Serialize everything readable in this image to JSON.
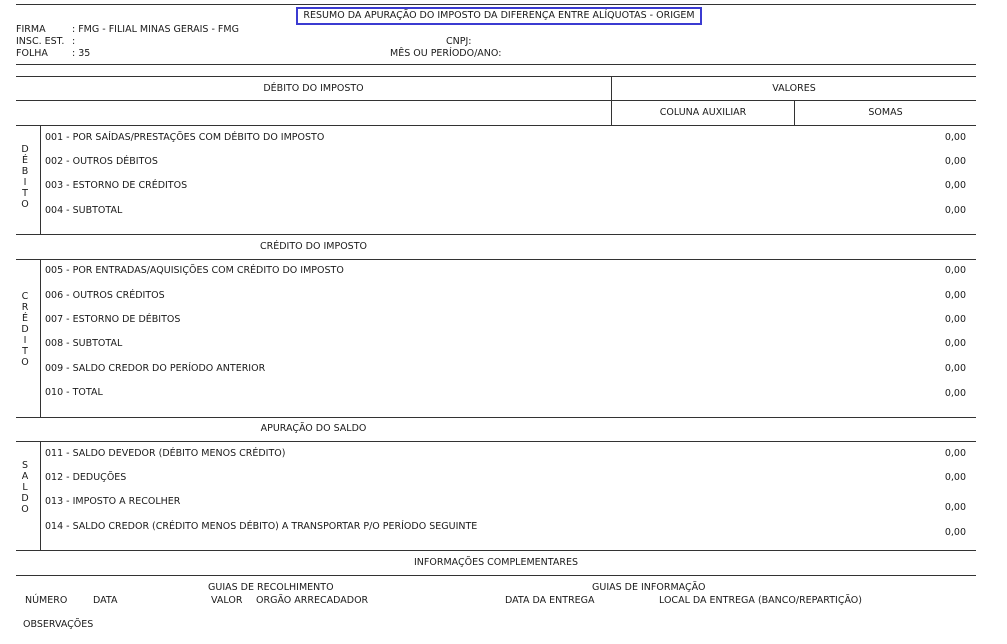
{
  "title": "RESUMO DA APURAÇÃO DO IMPOSTO DA DIFERENÇA ENTRE ALÍQUOTAS - ORIGEM",
  "header": {
    "firma_label": "FIRMA",
    "firma_value": ": FMG - FILIAL MINAS GERAIS - FMG",
    "insc_label": "INSC. EST.",
    "insc_value": ":",
    "folha_label": "FOLHA",
    "folha_value": ": 35",
    "cnpj_label": "CNPJ:",
    "periodo_label": "MÊS OU PERÍODO/ANO:"
  },
  "table_head": {
    "debito_imposto": "DÉBITO DO IMPOSTO",
    "valores": "VALORES",
    "coluna_auxiliar": "COLUNA AUXILIAR",
    "somas": "SOMAS"
  },
  "debito": {
    "side": "DÉBITO",
    "rows": [
      {
        "label": "001 - POR SAÍDAS/PRESTAÇÕES COM DÉBITO DO IMPOSTO",
        "value": "0,00"
      },
      {
        "label": "002 - OUTROS DÉBITOS",
        "value": "0,00"
      },
      {
        "label": "003 - ESTORNO DE CRÉDITOS",
        "value": "0,00"
      },
      {
        "label": "004 - SUBTOTAL",
        "value": "0,00"
      }
    ]
  },
  "credito": {
    "heading": "CRÉDITO DO IMPOSTO",
    "side": "CRÉDITO",
    "rows": [
      {
        "label": "005 - POR ENTRADAS/AQUISIÇÕES COM CRÉDITO DO IMPOSTO",
        "value": "0,00"
      },
      {
        "label": "006 - OUTROS CRÉDITOS",
        "value": "0,00"
      },
      {
        "label": "007 - ESTORNO DE DÉBITOS",
        "value": "0,00"
      },
      {
        "label": "008 - SUBTOTAL",
        "value": "0,00"
      },
      {
        "label": "009 - SALDO CREDOR DO PERÍODO ANTERIOR",
        "value": "0,00"
      },
      {
        "label": "010 - TOTAL",
        "value": "0,00"
      }
    ]
  },
  "saldo": {
    "heading": "APURAÇÃO DO SALDO",
    "side": "SALDO",
    "rows": [
      {
        "label": "011 - SALDO DEVEDOR (DÉBITO MENOS CRÉDITO)",
        "value": "0,00"
      },
      {
        "label": "012 - DEDUÇÕES",
        "value": "0,00"
      },
      {
        "label": "013 - IMPOSTO A RECOLHER",
        "value": "0,00"
      },
      {
        "label": "014 - SALDO CREDOR (CRÉDITO MENOS DÉBITO) A TRANSPORTAR P/O PERÍODO SEGUINTE",
        "value": "0,00"
      }
    ]
  },
  "complementares": {
    "heading": "INFORMAÇÕES COMPLEMENTARES",
    "guias_recolhimento": "GUIAS DE RECOLHIMENTO",
    "guias_informacao": "GUIAS DE INFORMAÇÃO",
    "numero": "NÚMERO",
    "data": "DATA",
    "valor": "VALOR",
    "orgao": "ORGÃO ARRECADADOR",
    "data_entrega": "DATA DA ENTREGA",
    "local_entrega": "LOCAL DA ENTREGA (BANCO/REPARTIÇÃO)",
    "observacoes": "OBSERVAÇÕES"
  }
}
